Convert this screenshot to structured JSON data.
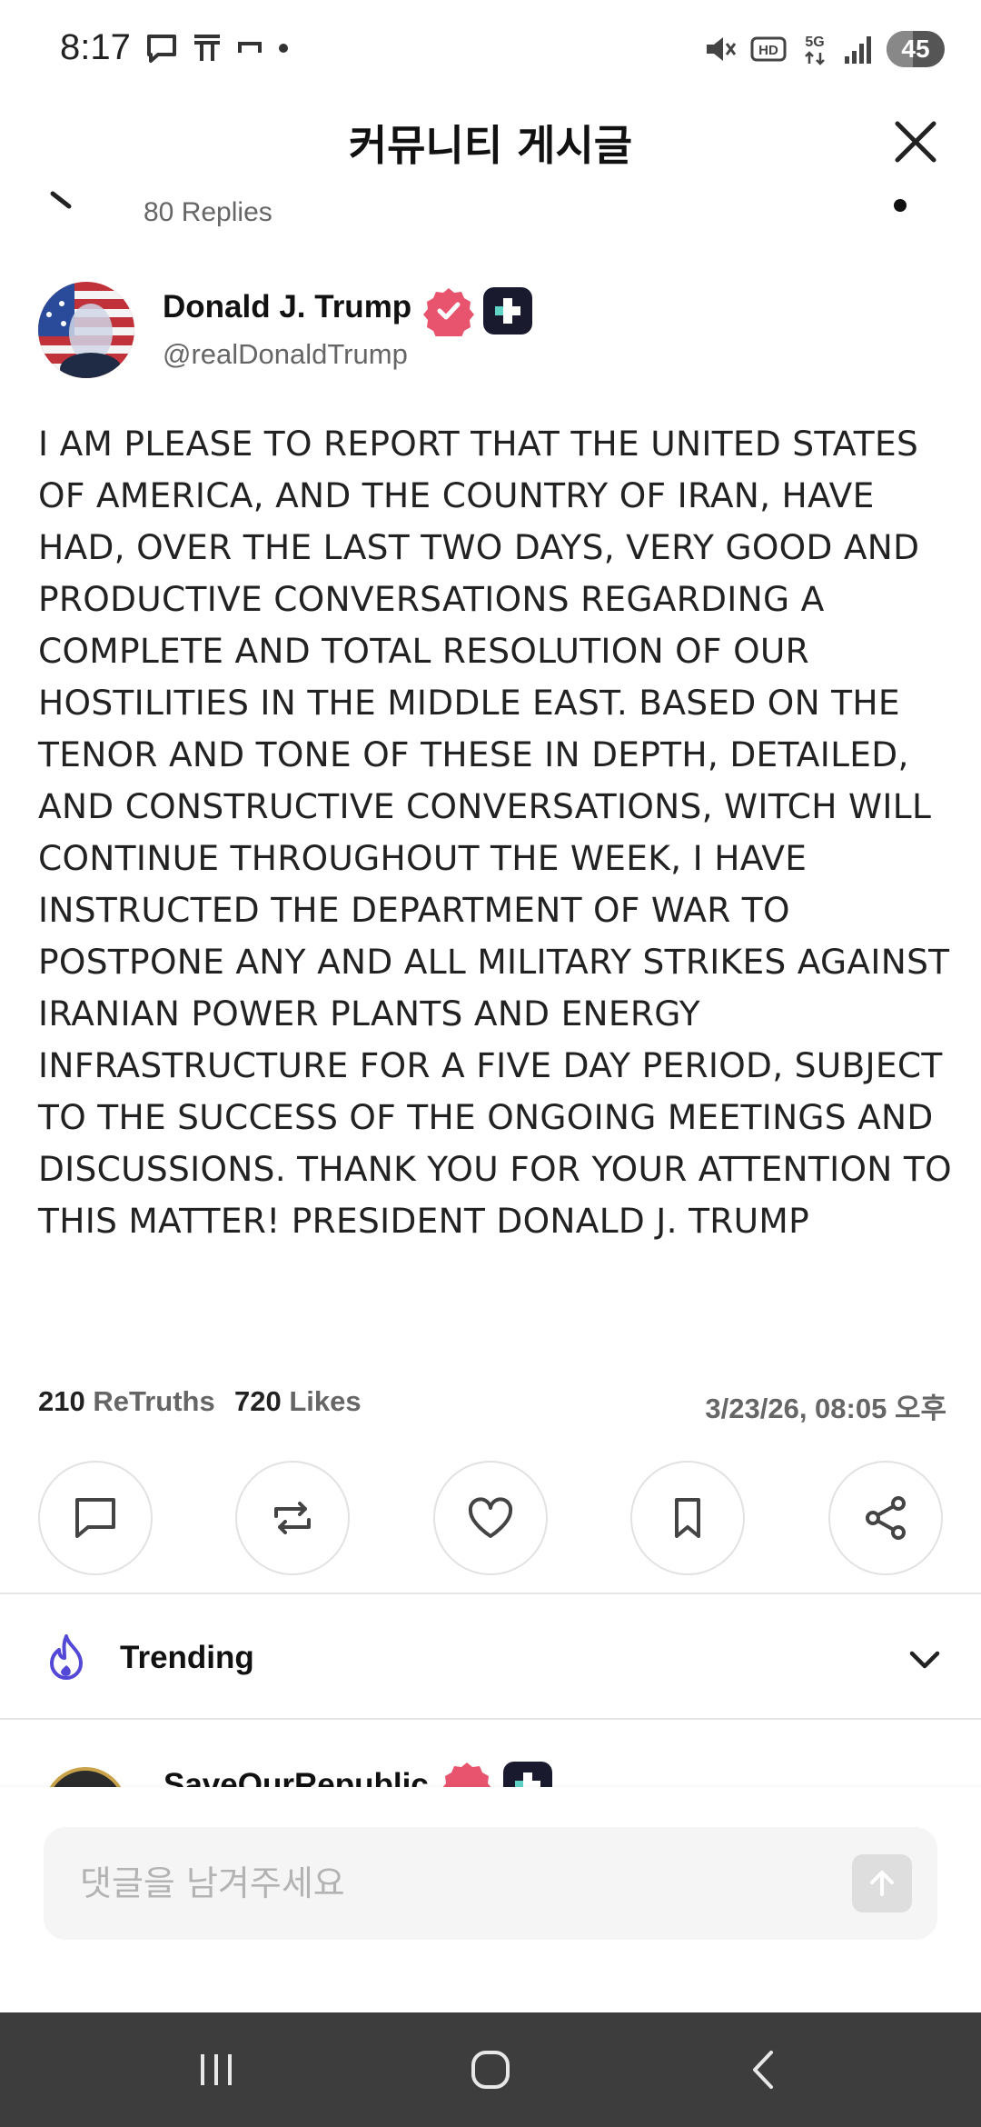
{
  "status_bar": {
    "time": "8:17",
    "battery": "45",
    "battery_level": 0.45
  },
  "header": {
    "title": "커뮤니티 게시글"
  },
  "post": {
    "replies": "80 Replies",
    "author_name": "Donald J. Trump",
    "author_handle": "@realDonaldTrump",
    "body": "I AM PLEASE TO REPORT THAT THE UNITED STATES OF AMERICA, AND THE COUNTRY OF IRAN, HAVE HAD, OVER THE LAST TWO DAYS, VERY GOOD AND PRODUCTIVE CONVERSATIONS REGARDING A COMPLETE AND TOTAL RESOLUTION OF OUR HOSTILITIES IN THE MIDDLE EAST. BASED ON THE TENOR AND TONE OF THESE IN DEPTH, DETAILED, AND CONSTRUCTIVE CONVERSATIONS, WITCH WILL CONTINUE THROUGHOUT THE WEEK, I HAVE INSTRUCTED THE DEPARTMENT OF WAR TO POSTPONE ANY AND ALL MILITARY STRIKES AGAINST IRANIAN POWER PLANTS AND ENERGY INFRASTRUCTURE FOR A FIVE DAY PERIOD, SUBJECT TO THE SUCCESS OF THE ONGOING MEETINGS AND DISCUSSIONS. THANK YOU FOR YOUR ATTENTION TO THIS MATTER! PRESIDENT DONALD J. TRUMP",
    "retruths_count": "210",
    "retruths_label": "ReTruths",
    "likes_count": "720",
    "likes_label": "Likes",
    "timestamp": "3/23/26, 08:05 오후"
  },
  "trending": {
    "label": "Trending"
  },
  "next_post": {
    "author_name": "SaveOurRepublic"
  },
  "comment": {
    "placeholder": "댓글을 남겨주세요"
  },
  "colors": {
    "verified": "#e8546e",
    "trending_icon": "#5448d6",
    "nav_bar": "#3d3d3d"
  }
}
